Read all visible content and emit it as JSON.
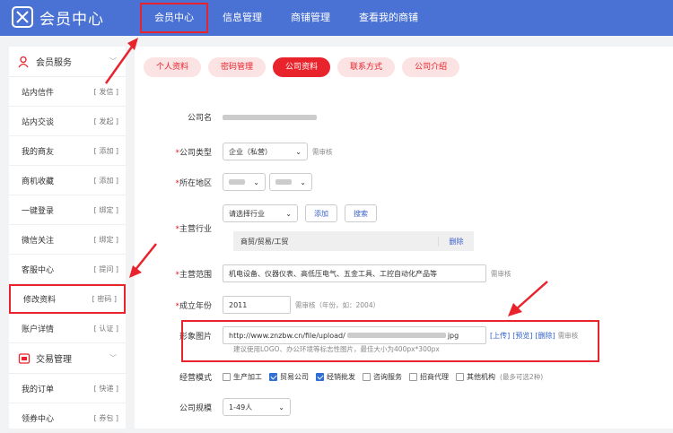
{
  "app": {
    "logo_text": "会员中心"
  },
  "nav": [
    {
      "label": "会员中心"
    },
    {
      "label": "信息管理"
    },
    {
      "label": "商铺管理"
    },
    {
      "label": "查看我的商铺"
    }
  ],
  "sidebar": {
    "section1": "会员服务",
    "items": [
      {
        "label": "站内信件",
        "tag": "[ 发信 ]"
      },
      {
        "label": "站内交谈",
        "tag": "[ 发起 ]"
      },
      {
        "label": "我的商友",
        "tag": "[ 添加 ]"
      },
      {
        "label": "商机收藏",
        "tag": "[ 添加 ]"
      },
      {
        "label": "一键登录",
        "tag": "[ 绑定 ]"
      },
      {
        "label": "微信关注",
        "tag": "[ 绑定 ]"
      },
      {
        "label": "客服中心",
        "tag": "[ 提问 ]"
      },
      {
        "label": "修改资料",
        "tag": "[ 密码 ]"
      },
      {
        "label": "账户详情",
        "tag": "[ 认证 ]"
      }
    ],
    "section2": "交易管理",
    "items2": [
      {
        "label": "我的订单",
        "tag": "[ 快递 ]"
      },
      {
        "label": "领券中心",
        "tag": "[ 券包 ]"
      }
    ]
  },
  "tabs": [
    {
      "label": "个人资料"
    },
    {
      "label": "密码管理"
    },
    {
      "label": "公司资料"
    },
    {
      "label": "联系方式"
    },
    {
      "label": "公司介绍"
    }
  ],
  "form": {
    "company_name_label": "公司名",
    "company_type_label": "公司类型",
    "company_type_value": "企业（私营）",
    "need_review": "需审核",
    "region_label": "所在地区",
    "industry_label": "主营行业",
    "industry_select": "请选择行业",
    "add_btn": "添加",
    "search_btn": "搜索",
    "industry_row": "商贸/贸易/工贸",
    "delete": "删除",
    "scope_label": "主营范围",
    "scope_value": "机电设备、仪器仪表、高低压电气、五金工具、工控自动化产品等",
    "year_label": "成立年份",
    "year_value": "2011",
    "year_note": "需审核（年份，如：2004）",
    "image_label": "形象图片",
    "image_value_start": "http://www.znzbw.cn/file/upload/",
    "image_value_end": "jpg",
    "upload": "[上传]",
    "preview": "[预览]",
    "del": "[删除]",
    "image_hint": "建议使用LOGO、办公环境等标志性图片，最佳大小为400px*300px",
    "mode_label": "经营模式",
    "modes": [
      {
        "label": "生产加工",
        "checked": false
      },
      {
        "label": "贸易公司",
        "checked": true
      },
      {
        "label": "经销批发",
        "checked": true
      },
      {
        "label": "咨询服务",
        "checked": false
      },
      {
        "label": "招商代理",
        "checked": false
      },
      {
        "label": "其他机构",
        "checked": false
      }
    ],
    "mode_note": "(最多可选2种)",
    "size_label": "公司规模",
    "size_value": "1-49人"
  }
}
